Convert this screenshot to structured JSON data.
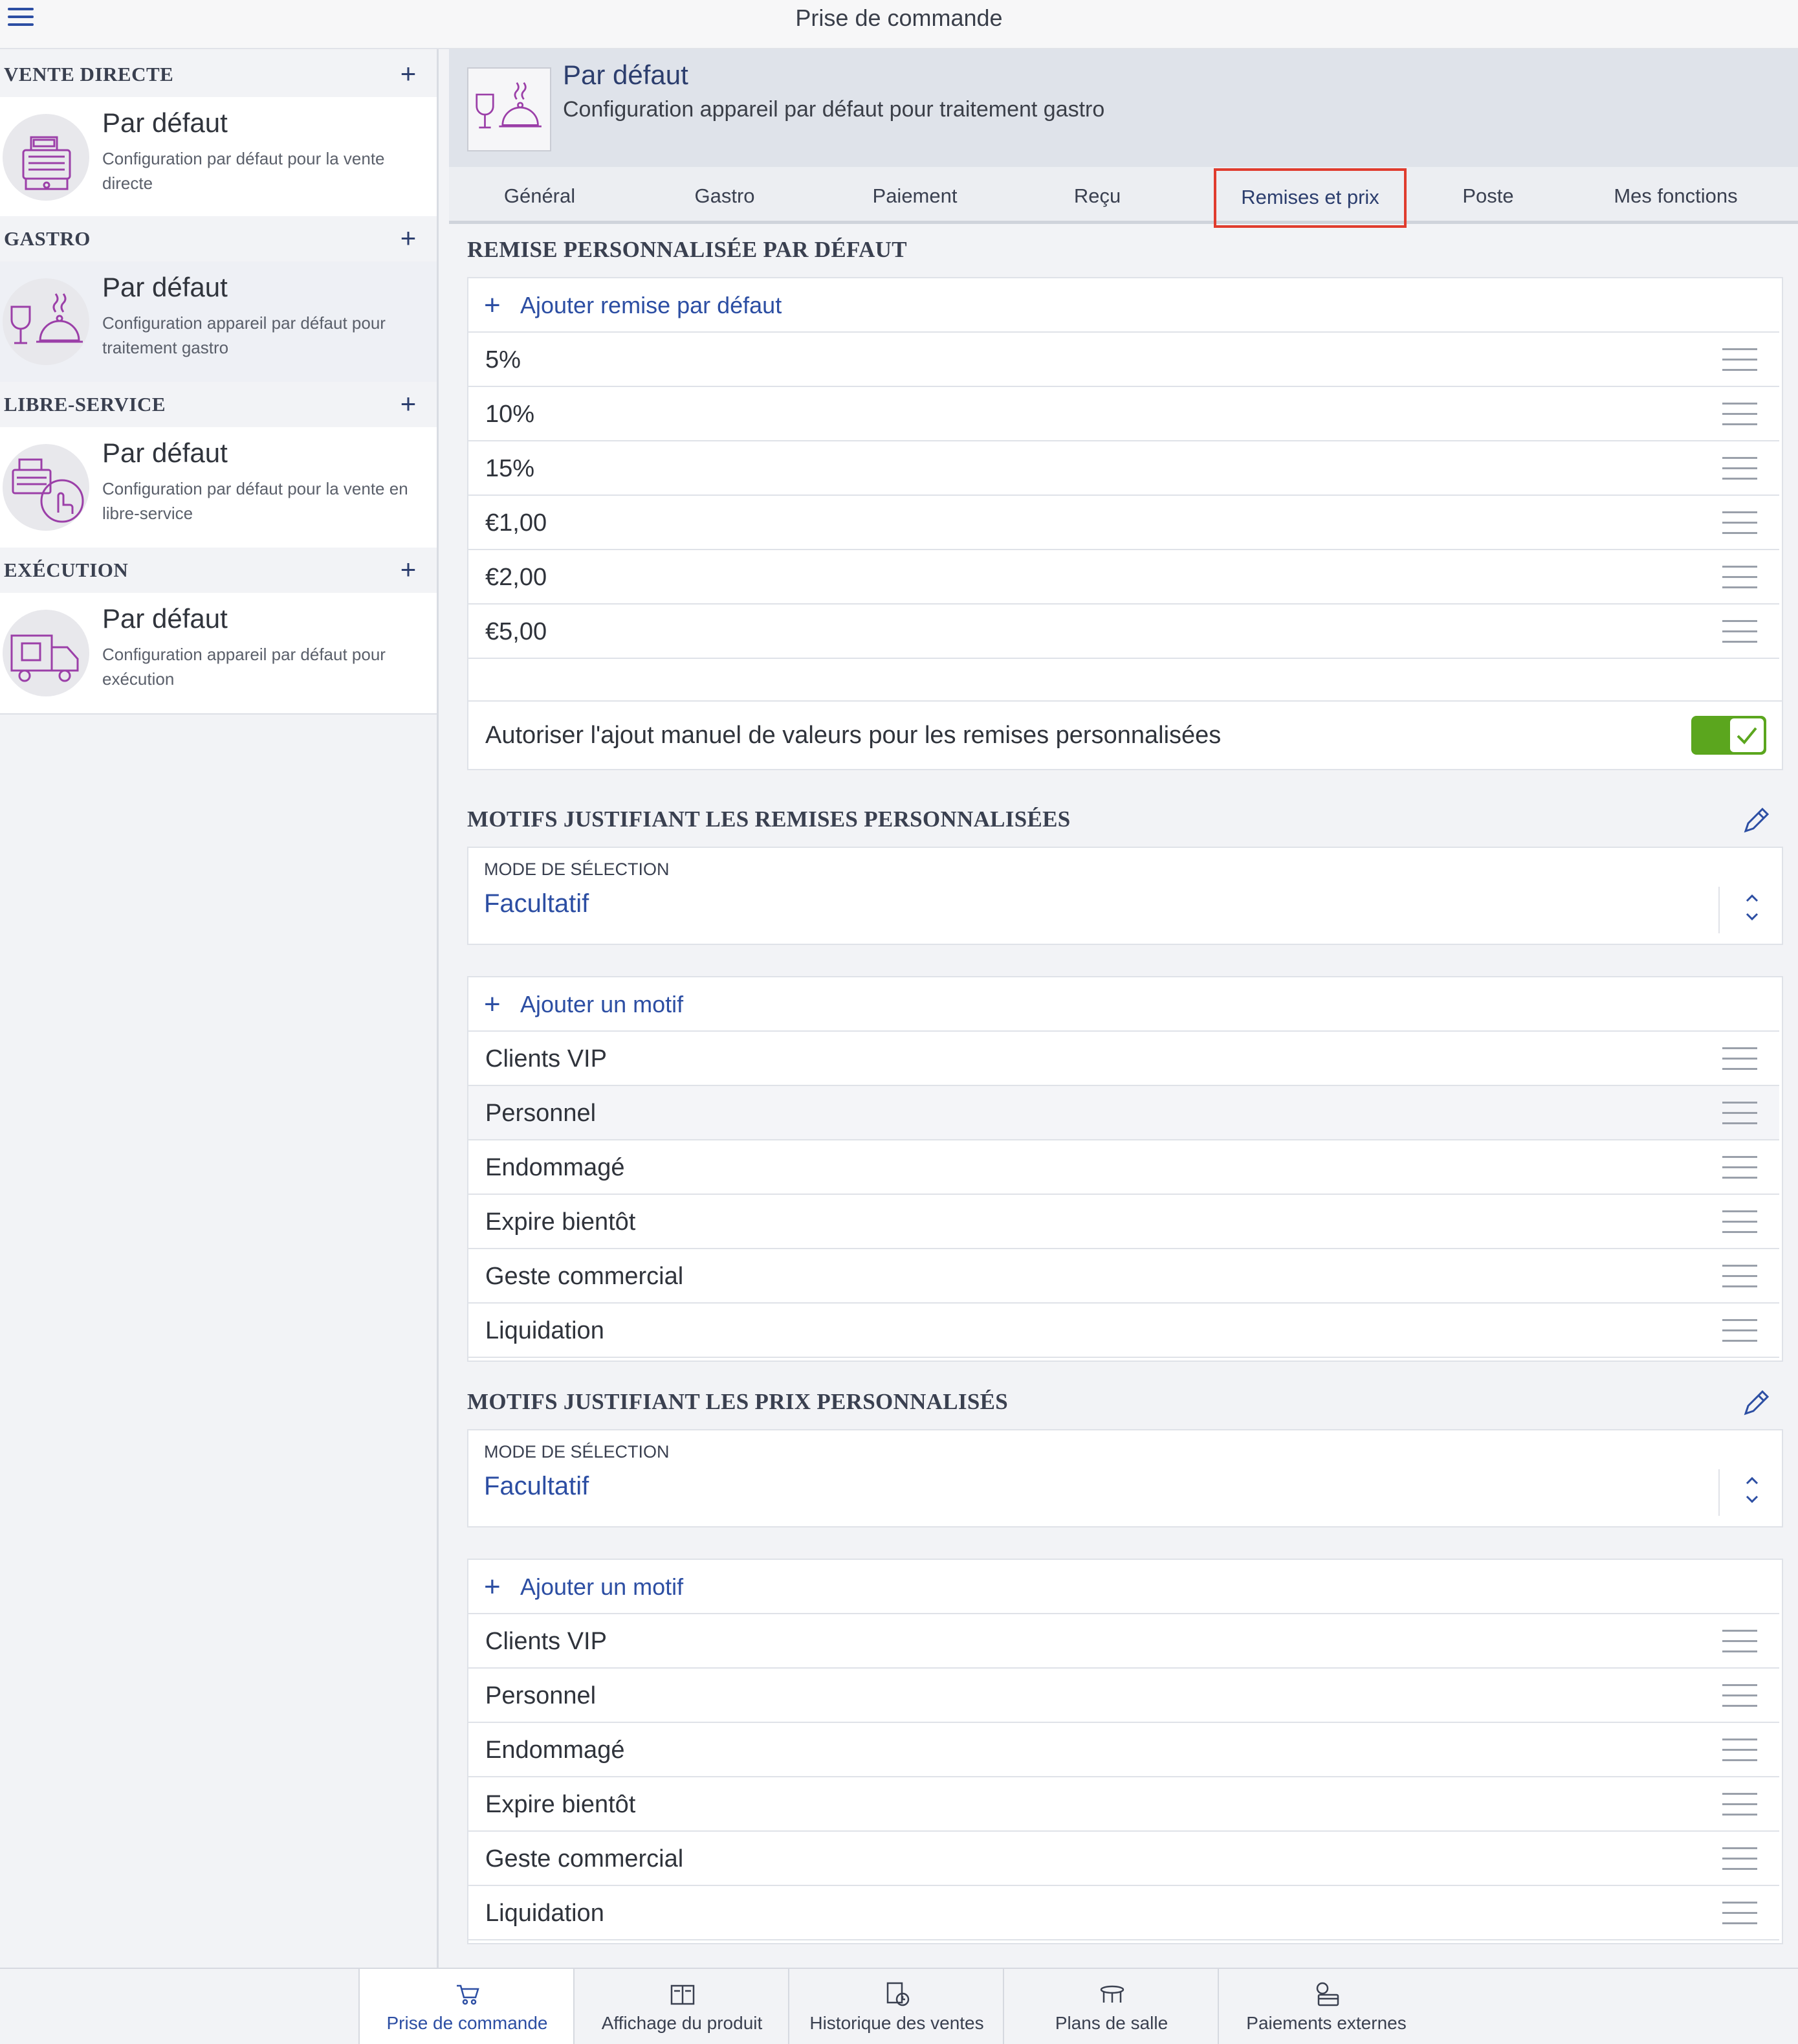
{
  "app": {
    "title": "Prise de commande"
  },
  "colors": {
    "accent": "#2c4ea3",
    "toggle_on": "#5ba61e",
    "active_tab_outline": "#e03c2e"
  },
  "sidebar": {
    "sections": [
      {
        "label": "VENTE DIRECTE",
        "add_icon": "plus-icon",
        "item": {
          "title": "Par défaut",
          "subtitle": "Configuration par défaut pour la vente directe",
          "icon": "cash-register-icon"
        }
      },
      {
        "label": "GASTRO",
        "add_icon": "plus-icon",
        "item": {
          "title": "Par défaut",
          "subtitle": "Configuration appareil par défaut pour traitement gastro",
          "icon": "gastro-icon",
          "selected": true
        }
      },
      {
        "label": "LIBRE-SERVICE",
        "add_icon": "plus-icon",
        "item": {
          "title": "Par défaut",
          "subtitle": "Configuration par défaut pour la vente en libre-service",
          "icon": "self-service-icon"
        }
      },
      {
        "label": "EXÉCUTION",
        "add_icon": "plus-icon",
        "item": {
          "title": "Par défaut",
          "subtitle": "Configuration appareil par défaut pour exécution",
          "icon": "delivery-truck-icon"
        }
      }
    ]
  },
  "header": {
    "title": "Par défaut",
    "subtitle": "Configuration appareil par défaut pour traitement gastro",
    "icon": "gastro-icon"
  },
  "tabs": [
    {
      "label": "Général"
    },
    {
      "label": "Gastro"
    },
    {
      "label": "Paiement"
    },
    {
      "label": "Reçu"
    },
    {
      "label": "Remises et prix",
      "active": true
    },
    {
      "label": "Poste"
    },
    {
      "label": "Mes fonctions"
    }
  ],
  "discounts": {
    "title": "REMISE PERSONNALISÉE PAR DÉFAUT",
    "add_label": "Ajouter remise par défaut",
    "items": [
      "5%",
      "10%",
      "15%",
      "€1,00",
      "€2,00",
      "€5,00"
    ]
  },
  "manual_toggle": {
    "label": "Autoriser l'ajout manuel de valeurs pour les remises personnalisées",
    "enabled": true
  },
  "discount_reasons": {
    "title": "MOTIFS JUSTIFIANT LES REMISES PERSONNALISÉES",
    "selection_label": "MODE DE SÉLECTION",
    "selection_value": "Facultatif",
    "add_label": "Ajouter un motif",
    "items": [
      "Clients VIP",
      "Personnel",
      "Endommagé",
      "Expire bientôt",
      "Geste commercial",
      "Liquidation"
    ]
  },
  "price_reasons": {
    "title": "MOTIFS JUSTIFIANT LES PRIX PERSONNALISÉS",
    "selection_label": "MODE DE SÉLECTION",
    "selection_value": "Facultatif",
    "add_label": "Ajouter un motif",
    "items": [
      "Clients VIP",
      "Personnel",
      "Endommagé",
      "Expire bientôt",
      "Geste commercial",
      "Liquidation"
    ]
  },
  "bottom_nav": [
    {
      "label": "Prise de commande",
      "icon": "cart-icon",
      "active": true
    },
    {
      "label": "Affichage du produit",
      "icon": "product-display-icon"
    },
    {
      "label": "Historique des ventes",
      "icon": "sales-history-icon"
    },
    {
      "label": "Plans de salle",
      "icon": "table-icon"
    },
    {
      "label": "Paiements externes",
      "icon": "external-payment-icon"
    }
  ]
}
